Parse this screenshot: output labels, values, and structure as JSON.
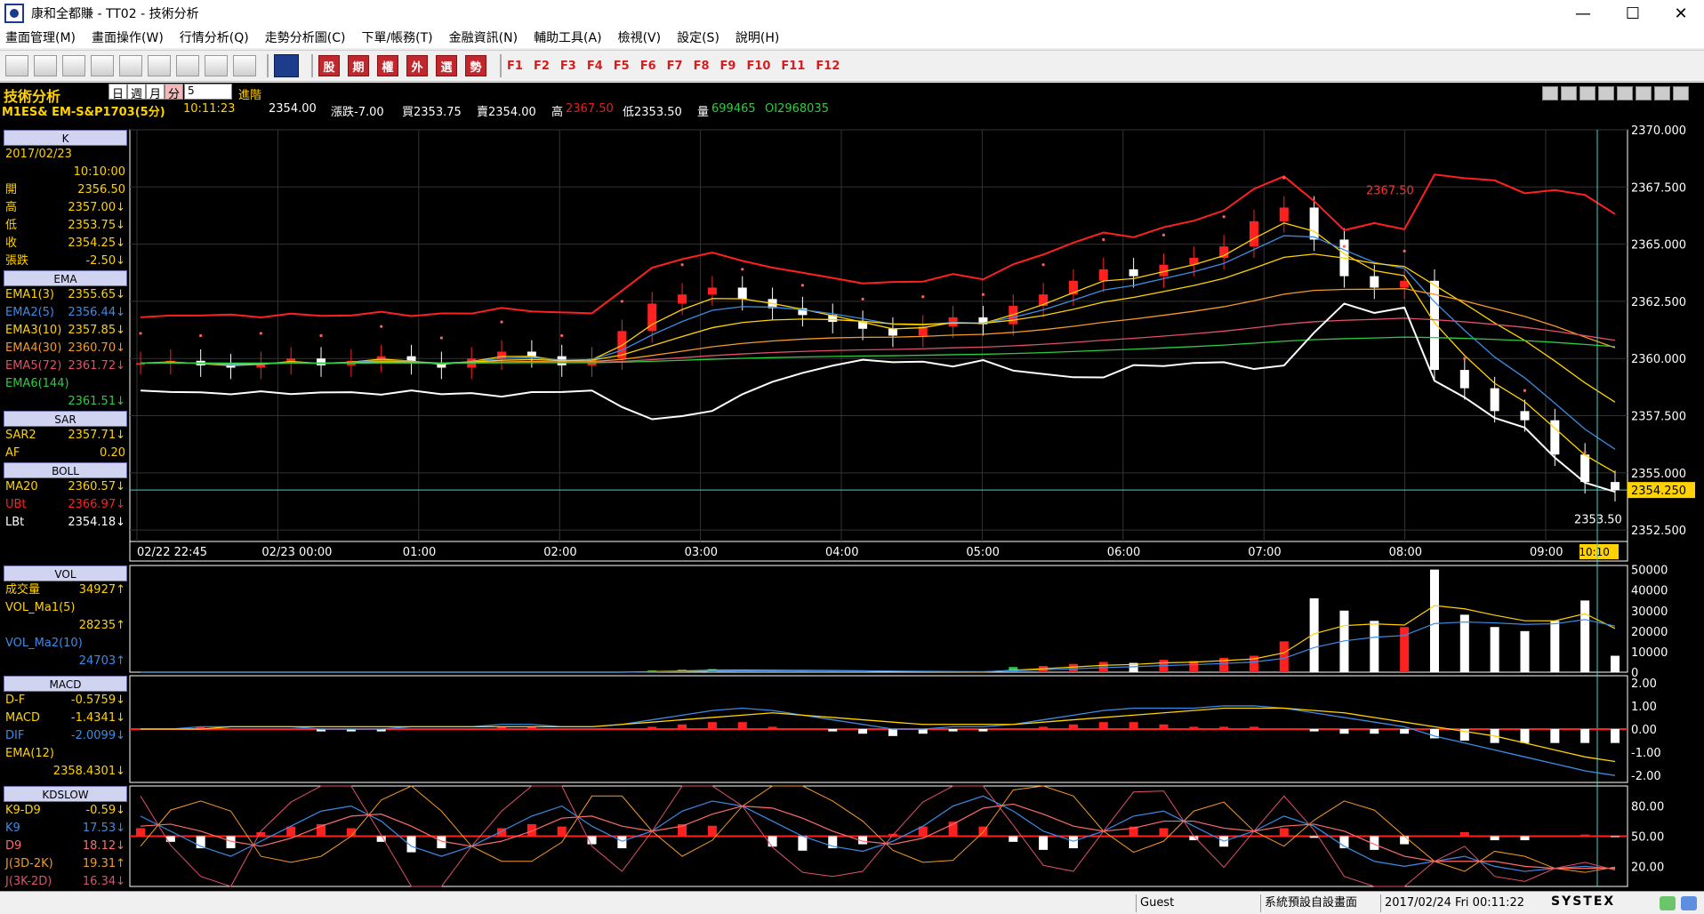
{
  "window": {
    "title": "康和全都賺 - TT02 - 技術分析",
    "minimize": "—",
    "maximize": "☐",
    "close": "✕"
  },
  "menu": [
    "畫面管理(M)",
    "畫面操作(W)",
    "行情分析(Q)",
    "走勢分析圖(C)",
    "下單/帳務(T)",
    "金融資訊(N)",
    "輔助工具(A)",
    "檢視(V)",
    "設定(S)",
    "說明(H)"
  ],
  "toolbar": {
    "red_buttons": [
      "股",
      "期",
      "權",
      "外",
      "選",
      "勢"
    ],
    "fkeys": [
      "F1",
      "F2",
      "F3",
      "F4",
      "F5",
      "F6",
      "F7",
      "F8",
      "F9",
      "F10",
      "F11",
      "F12"
    ]
  },
  "header": {
    "title": "技術分析",
    "tabs": [
      "日",
      "週",
      "月",
      "分"
    ],
    "period_value": "5",
    "advanced": "進階"
  },
  "quote": {
    "symbol": "M1ES& EM-S&P1703(5分)",
    "time": "10:11:23",
    "last": "2354.00",
    "change": "漲跌-7.00",
    "bid": "買2353.75",
    "ask": "賣2354.00",
    "high_label": "高",
    "high": "2367.50",
    "low": "低2353.50",
    "volume_label": "量",
    "volume": "699465",
    "oi": "OI2968035"
  },
  "sidebar": {
    "k_header": "K",
    "date": "2017/02/23",
    "time": "10:10:00",
    "ohlc": [
      {
        "label": "開",
        "value": "2356.50"
      },
      {
        "label": "高",
        "value": "2357.00↓"
      },
      {
        "label": "低",
        "value": "2353.75↓"
      },
      {
        "label": "收",
        "value": "2354.25↓"
      },
      {
        "label": "張跌",
        "value": "-2.50↓"
      }
    ],
    "ema_header": "EMA",
    "ema": [
      {
        "label": "EMA1(3)",
        "value": "2355.65↓",
        "color": "#ffd200"
      },
      {
        "label": "EMA2(5)",
        "value": "2356.44↓",
        "color": "#3c8ce6"
      },
      {
        "label": "EMA3(10)",
        "value": "2357.85↓",
        "color": "#ffd200"
      },
      {
        "label": "EMA4(30)",
        "value": "2360.70↓",
        "color": "#f59a23"
      },
      {
        "label": "EMA5(72)",
        "value": "2361.72↓",
        "color": "#e0506a"
      },
      {
        "label": "EMA6(144)",
        "value": "",
        "color": "#2ecc40"
      },
      {
        "label": "",
        "value": "2361.51↓",
        "color": "#2ecc40"
      }
    ],
    "sar_header": "SAR",
    "sar": [
      {
        "label": "SAR2",
        "value": "2357.71↓"
      },
      {
        "label": "AF",
        "value": "0.20"
      }
    ],
    "boll_header": "BOLL",
    "boll": [
      {
        "label": "MA20",
        "value": "2360.57↓",
        "color": "#ffd200"
      },
      {
        "label": "UBt",
        "value": "2366.97↓",
        "color": "#ff2020"
      },
      {
        "label": "LBt",
        "value": "2354.18↓",
        "color": "#ffffff"
      }
    ],
    "vol_header": "VOL",
    "vol": [
      {
        "label": "成交量",
        "value": "34927↑",
        "color": "#ffd200"
      },
      {
        "label": "VOL_Ma1(5)",
        "value": "",
        "color": "#ffd200"
      },
      {
        "label": "",
        "value": "28235↑",
        "color": "#ffd200"
      },
      {
        "label": "VOL_Ma2(10)",
        "value": "",
        "color": "#3c8ce6"
      },
      {
        "label": "",
        "value": "24703↑",
        "color": "#3c8ce6"
      }
    ],
    "macd_header": "MACD",
    "macd": [
      {
        "label": "D-F",
        "value": "-0.5759↓",
        "color": "#ffd200"
      },
      {
        "label": "MACD",
        "value": "-1.4341↓",
        "color": "#ffd200"
      },
      {
        "label": "DIF",
        "value": "-2.0099↓",
        "color": "#3c8ce6"
      },
      {
        "label": "EMA(12)",
        "value": "",
        "color": "#ffd200"
      },
      {
        "label": "",
        "value": "2358.4301↓",
        "color": "#ffd200"
      }
    ],
    "kd_header": "KDSLOW",
    "kd": [
      {
        "label": "K9-D9",
        "value": "-0.59↓",
        "color": "#ffd200"
      },
      {
        "label": "K9",
        "value": "17.53↓",
        "color": "#3c8ce6"
      },
      {
        "label": "D9",
        "value": "18.12↓",
        "color": "#ff6b6b"
      },
      {
        "label": "J(3D-2K)",
        "value": "19.31↑",
        "color": "#f59a23"
      },
      {
        "label": "J(3K-2D)",
        "value": "16.34↓",
        "color": "#e0506a"
      }
    ]
  },
  "chart_data": {
    "type": "candlestick",
    "price_axis": {
      "ticks": [
        "2370.000",
        "2367.500",
        "2365.000",
        "2362.500",
        "2360.000",
        "2357.500",
        "2355.000",
        "2352.500"
      ],
      "range": [
        2352.0,
        2370.0
      ]
    },
    "time_axis": [
      "02/22 22:45",
      "02/23 00:00",
      "01:00",
      "02:00",
      "03:00",
      "04:00",
      "05:00",
      "06:00",
      "07:00",
      "08:00",
      "09:00"
    ],
    "current_time_label": "10:10:10",
    "last_price_marker": "2354.250",
    "high_marker": "2367.50",
    "low_marker": "2353.50",
    "price_series": [
      2359.8,
      2359.9,
      2359.7,
      2359.6,
      2359.8,
      2360.0,
      2359.7,
      2359.9,
      2360.1,
      2359.8,
      2359.6,
      2360.0,
      2360.3,
      2360.1,
      2359.7,
      2360.0,
      2361.2,
      2362.4,
      2362.8,
      2363.1,
      2362.6,
      2362.2,
      2361.9,
      2361.6,
      2361.3,
      2361.0,
      2361.4,
      2361.8,
      2361.5,
      2362.3,
      2362.8,
      2363.4,
      2363.9,
      2363.6,
      2364.1,
      2364.4,
      2364.9,
      2366.0,
      2366.6,
      2365.2,
      2363.6,
      2363.1,
      2363.4,
      2359.5,
      2358.7,
      2357.7,
      2357.3,
      2355.8,
      2354.6,
      2354.25
    ],
    "volume_axis": {
      "ticks": [
        "50000",
        "40000",
        "30000",
        "20000",
        "10000",
        "0"
      ],
      "range": [
        0,
        52000
      ]
    },
    "volume_series": [
      0,
      0,
      0,
      0,
      0,
      0,
      0,
      0,
      0,
      0,
      0,
      0,
      0,
      0,
      0,
      0,
      0,
      800,
      1200,
      1500,
      1100,
      900,
      700,
      600,
      500,
      0,
      0,
      0,
      0,
      2500,
      3000,
      4000,
      5000,
      4500,
      6000,
      5500,
      7000,
      8000,
      15000,
      36000,
      30000,
      25000,
      22000,
      50000,
      28000,
      22000,
      20000,
      25000,
      34927,
      8000
    ],
    "macd_axis": {
      "ticks": [
        "2.00",
        "1.00",
        "0.00",
        "-1.00",
        "-2.00"
      ],
      "range": [
        -2.3,
        2.3
      ]
    },
    "macd_dif": [
      0,
      0,
      0.1,
      0.1,
      0.1,
      0.1,
      0,
      0,
      0,
      0.1,
      0.1,
      0.1,
      0.2,
      0.2,
      0.1,
      0.1,
      0.2,
      0.4,
      0.6,
      0.8,
      0.9,
      0.8,
      0.6,
      0.4,
      0.2,
      0,
      0,
      0.1,
      0.1,
      0.2,
      0.4,
      0.6,
      0.8,
      0.9,
      0.9,
      0.9,
      1.0,
      1.0,
      0.9,
      0.7,
      0.5,
      0.3,
      0.1,
      -0.3,
      -0.6,
      -0.9,
      -1.2,
      -1.5,
      -1.8,
      -2.0
    ],
    "macd_signal": [
      0,
      0,
      0,
      0.1,
      0.1,
      0.1,
      0.1,
      0.1,
      0.1,
      0.1,
      0.1,
      0.1,
      0.1,
      0.1,
      0.1,
      0.1,
      0.2,
      0.3,
      0.4,
      0.5,
      0.6,
      0.7,
      0.6,
      0.5,
      0.4,
      0.3,
      0.2,
      0.2,
      0.2,
      0.2,
      0.3,
      0.4,
      0.5,
      0.6,
      0.7,
      0.8,
      0.9,
      0.9,
      0.9,
      0.8,
      0.7,
      0.5,
      0.3,
      0.1,
      -0.1,
      -0.3,
      -0.6,
      -0.9,
      -1.2,
      -1.4
    ],
    "kd_axis": {
      "ticks": [
        "80.00",
        "50.00",
        "20.00"
      ],
      "range": [
        0,
        100
      ]
    },
    "kd_k": [
      70,
      55,
      40,
      30,
      45,
      60,
      75,
      80,
      65,
      40,
      30,
      40,
      55,
      70,
      80,
      60,
      45,
      55,
      75,
      85,
      80,
      65,
      50,
      40,
      35,
      45,
      60,
      80,
      90,
      75,
      55,
      45,
      55,
      70,
      75,
      60,
      45,
      55,
      70,
      60,
      40,
      25,
      20,
      25,
      30,
      20,
      15,
      18,
      20,
      17.53
    ],
    "kd_d": [
      60,
      62,
      55,
      45,
      40,
      48,
      60,
      70,
      72,
      60,
      45,
      40,
      45,
      55,
      68,
      70,
      60,
      55,
      60,
      72,
      80,
      78,
      68,
      55,
      45,
      42,
      48,
      62,
      78,
      82,
      72,
      60,
      55,
      58,
      65,
      65,
      58,
      55,
      60,
      62,
      55,
      42,
      30,
      25,
      25,
      25,
      20,
      18,
      18,
      18.12
    ]
  }
}
